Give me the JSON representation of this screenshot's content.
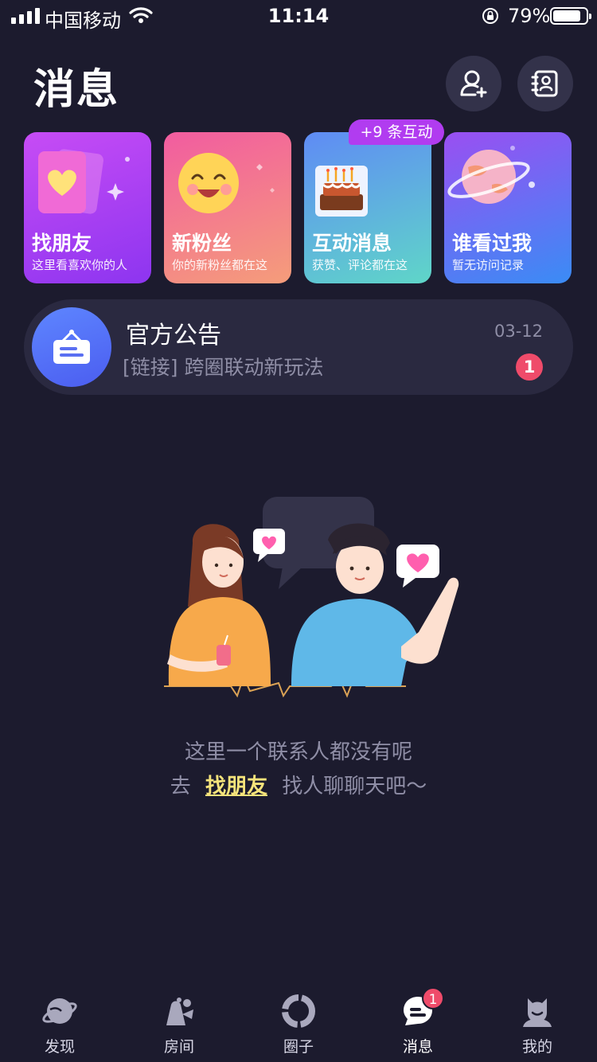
{
  "status_bar": {
    "carrier": "中国移动",
    "time": "11:14",
    "battery_pct": "79%",
    "battery_level": 0.79
  },
  "header": {
    "title": "消息",
    "add_friend_icon": "add-friend-icon",
    "contacts_icon": "contacts-book-icon"
  },
  "cards": [
    {
      "title": "找朋友",
      "subtitle": "这里看喜欢你的人"
    },
    {
      "title": "新粉丝",
      "subtitle": "你的新粉丝都在这"
    },
    {
      "title": "互动消息",
      "subtitle": "获赞、评论都在这",
      "badge": "+9 条互动"
    },
    {
      "title": "谁看过我",
      "subtitle": "暂无访问记录"
    }
  ],
  "notice": {
    "title": "官方公告",
    "preview": "[链接] 跨圈联动新玩法",
    "date": "03-12",
    "unread": "1"
  },
  "empty_state": {
    "line1": "这里一个联系人都没有呢",
    "prefix": "去",
    "link": "找朋友",
    "suffix": "找人聊聊天吧～"
  },
  "tabs": [
    {
      "label": "发现",
      "icon": "planet-icon"
    },
    {
      "label": "房间",
      "icon": "room-icon"
    },
    {
      "label": "圈子",
      "icon": "circle-icon"
    },
    {
      "label": "消息",
      "icon": "message-icon",
      "badge": "1",
      "active": true
    },
    {
      "label": "我的",
      "icon": "profile-icon"
    }
  ],
  "colors": {
    "background": "#1c1b2e",
    "accent_pink": "#ef4b6a",
    "link_yellow": "#f6e47b"
  }
}
